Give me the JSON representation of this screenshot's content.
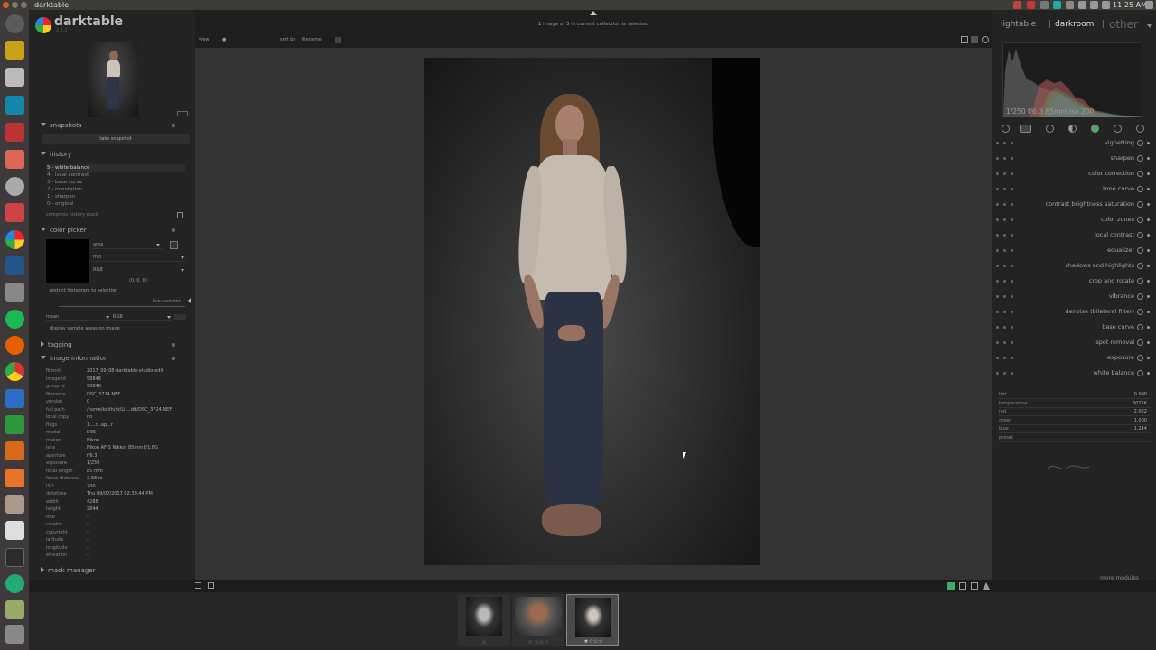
{
  "os": {
    "app_title": "darktable",
    "clock": "11:25 AM",
    "launcher_icons": [
      "ubuntu-icon",
      "terminal-app-icon",
      "camera-icon",
      "skype-icon",
      "app-icon",
      "files-icon",
      "settings-icon",
      "app-icon",
      "darktable-app-icon",
      "monitor-icon",
      "settings-icon",
      "spotify-icon",
      "firefox-icon",
      "chrome-icon",
      "writer-icon",
      "calc-icon",
      "impress-icon",
      "software-center-icon",
      "settings-icon",
      "amazon-icon",
      "terminal-icon",
      "browser-icon",
      "app-icon",
      "trash-icon"
    ]
  },
  "app": {
    "logo": "darktable",
    "version": "2.2.5",
    "status": "1 image of 3 in current collection is selected",
    "toolbar": {
      "view_label": "view",
      "view_value": "●",
      "sort_label": "sort by",
      "sort_value": "filename"
    },
    "views": {
      "lightable": "lightable",
      "separator": "|",
      "darkroom": "darkroom",
      "other": "other"
    }
  },
  "left": {
    "snapshots": {
      "title": "snapshots",
      "take_button": "take snapshot"
    },
    "history": {
      "title": "history",
      "items": [
        "5 - white balance",
        "4 - local contrast",
        "3 - base curve",
        "2 - orientation",
        "1 - sharpen",
        "0 - original"
      ],
      "compress": "compress history stack"
    },
    "color_picker": {
      "title": "color picker",
      "mode": "area",
      "stat": "min",
      "colorspace": "RGB",
      "values": "(0, 0, 0)",
      "restrict": "restrict histogram to selection",
      "live_samples": "live samples",
      "sample_stat": "mean",
      "sample_space": "RGB",
      "display_sample": "display sample areas on image",
      "swatch": "#000000"
    },
    "tagging": {
      "title": "tagging"
    },
    "image_info": {
      "title": "image information",
      "rows": [
        {
          "label": "filmroll",
          "value": "2017_09_08-darktable-studio-edit"
        },
        {
          "label": "image id",
          "value": "58848"
        },
        {
          "label": "group id",
          "value": "58848"
        },
        {
          "label": "filename",
          "value": "DSC_3724.NEF"
        },
        {
          "label": "version",
          "value": "0"
        },
        {
          "label": "full path",
          "value": "/home/keith/nt/Li....dit/DSC_3724.NEF"
        },
        {
          "label": "local copy",
          "value": "no"
        },
        {
          "label": "flags",
          "value": "1....r...ap...r"
        },
        {
          "label": "model",
          "value": "D35"
        },
        {
          "label": "maker",
          "value": "Nikon"
        },
        {
          "label": "lens",
          "value": "Nikon AF-S Nikkor 85mm f/1.8G"
        },
        {
          "label": "aperture",
          "value": "f/6.3"
        },
        {
          "label": "exposure",
          "value": "1/250"
        },
        {
          "label": "focal length",
          "value": "85 mm"
        },
        {
          "label": "focus distance",
          "value": "2.98 m"
        },
        {
          "label": "ISO",
          "value": "200"
        },
        {
          "label": "datetime",
          "value": "Thu 09/07/2017 02:38:44 PM"
        },
        {
          "label": "width",
          "value": "4288"
        },
        {
          "label": "height",
          "value": "2844"
        },
        {
          "label": "title",
          "value": "-"
        },
        {
          "label": "creator",
          "value": "-"
        },
        {
          "label": "copyright",
          "value": "-"
        },
        {
          "label": "latitude",
          "value": "-"
        },
        {
          "label": "longitude",
          "value": "-"
        },
        {
          "label": "elevation",
          "value": "-"
        }
      ]
    },
    "mask_manager": {
      "title": "mask manager"
    }
  },
  "right": {
    "histogram_info": "1/250 f/6.3 85mm iso 200",
    "groups": [
      "power-icon",
      "star-icon",
      "circle-icon",
      "half-circle-icon",
      "color-icon",
      "correct-icon",
      "effect-icon"
    ],
    "modules": [
      {
        "label": "vignetting",
        "icon": "vignette-icon"
      },
      {
        "label": "sharpen",
        "icon": "sharpen-icon"
      },
      {
        "label": "color correction",
        "icon": "color-correction-icon"
      },
      {
        "label": "tone curve",
        "icon": "tone-curve-icon"
      },
      {
        "label": "contrast brightness saturation",
        "icon": "saturation-icon"
      },
      {
        "label": "color zones",
        "icon": "color-zones-icon"
      },
      {
        "label": "local contrast",
        "icon": "local-contrast-icon"
      },
      {
        "label": "equalizer",
        "icon": "equalizer-icon"
      },
      {
        "label": "shadows and highlights",
        "icon": "shadows-icon"
      },
      {
        "label": "crop and rotate",
        "icon": "crop-icon"
      },
      {
        "label": "vibrance",
        "icon": "vibrance-icon"
      },
      {
        "label": "denoise (bilateral filter)",
        "icon": "denoise-icon"
      },
      {
        "label": "base curve",
        "icon": "base-curve-icon"
      },
      {
        "label": "spot removal",
        "icon": "spot-removal-icon"
      },
      {
        "label": "exposure",
        "icon": "exposure-icon"
      },
      {
        "label": "white balance",
        "icon": "white-balance-icon"
      }
    ],
    "white_balance": [
      {
        "label": "tint",
        "value": "0.990"
      },
      {
        "label": "temperature",
        "value": "6021K"
      },
      {
        "label": "red",
        "value": "2.022"
      },
      {
        "label": "green",
        "value": "1.000"
      },
      {
        "label": "blue",
        "value": "1.244"
      },
      {
        "label": "preset",
        "value": ""
      }
    ],
    "more_modules": "more modules"
  },
  "filmstrip": {
    "thumbs": [
      {
        "stars": "☆",
        "selected": false
      },
      {
        "stars": "☆ ☆☆☆",
        "selected": false
      },
      {
        "stars": "★☆☆☆",
        "selected": true
      }
    ]
  }
}
